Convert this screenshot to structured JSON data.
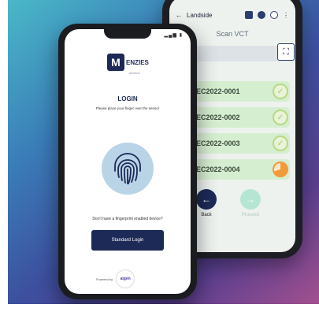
{
  "back_phone": {
    "status": {
      "back_arrow": "←",
      "screen": "Landside"
    },
    "title": "Scan VCT",
    "vct_items": [
      {
        "id": "R-14DEC2022-0001",
        "status": "complete"
      },
      {
        "id": "R-14DEC2022-0002",
        "status": "complete"
      },
      {
        "id": "R-14DEC2022-0003",
        "status": "complete"
      },
      {
        "id": "R-14DEC2022-0004",
        "status": "partial"
      }
    ],
    "nav": {
      "back_label": "Back",
      "proceed_label": "Proceed"
    }
  },
  "front_phone": {
    "logo": {
      "initial": "M",
      "text": "ENZIES",
      "sub": "aviation"
    },
    "heading": "LOGIN",
    "instruction": "Please place your finger over the sensor",
    "question": "Don't have a fingerprint enabled device?",
    "button_label": "Standard Login",
    "powered_by": "Powered by",
    "powered_logo": "aigen"
  },
  "colors": {
    "primary": "#1d2a57",
    "list_green": "#d6eed0",
    "status_green": "#b7d983",
    "status_orange": "#f29a38",
    "fingerprint_bg": "#b9d3e7"
  },
  "icons": [
    "fingerprint-icon",
    "scan-icon",
    "arrow-left-icon",
    "arrow-right-icon",
    "check-icon"
  ]
}
